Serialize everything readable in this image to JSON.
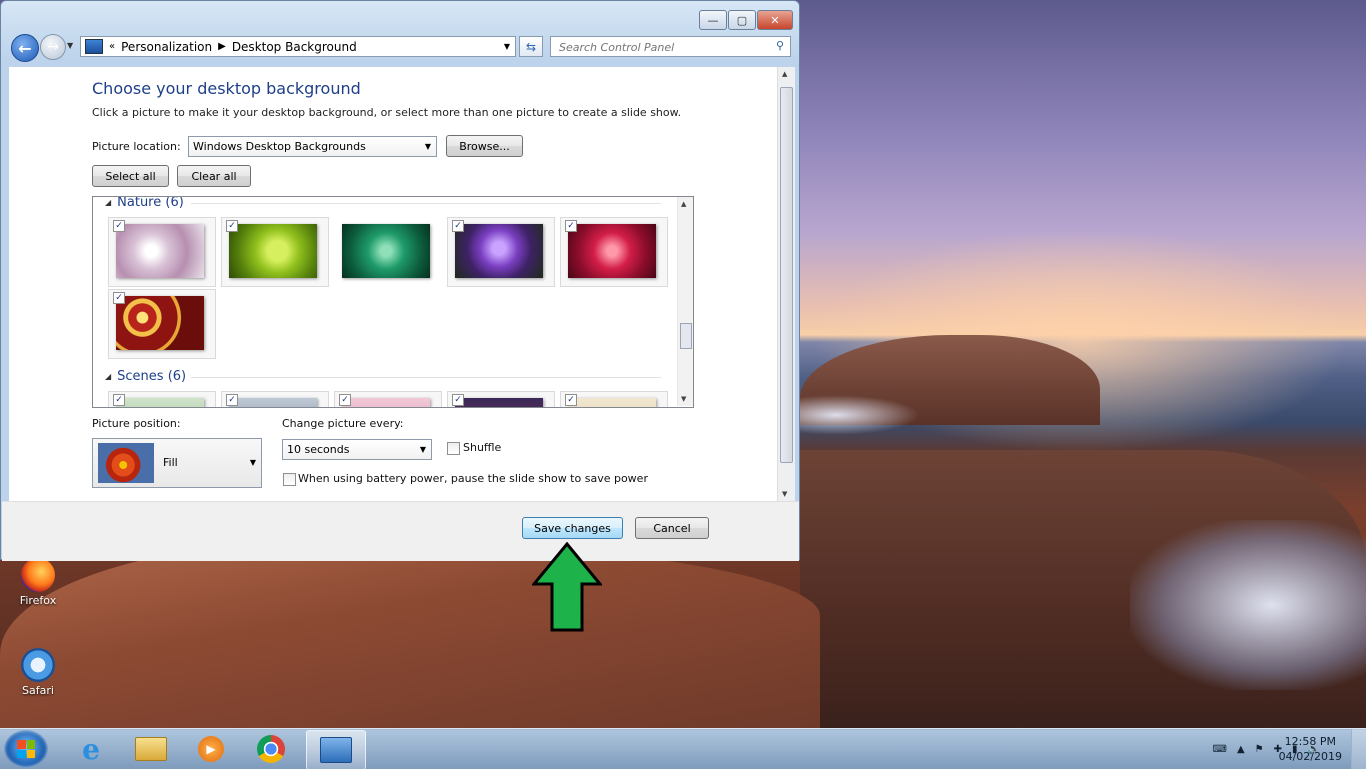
{
  "window": {
    "caption_buttons": {
      "minimize": "—",
      "maximize": "▢",
      "close": "✕"
    },
    "breadcrumb": {
      "prefix": "«",
      "items": [
        "Personalization",
        "Desktop Background"
      ]
    },
    "search_placeholder": "Search Control Panel"
  },
  "content": {
    "title": "Choose your desktop background",
    "description": "Click a picture to make it your desktop background, or select more than one picture to create a slide show.",
    "picture_location_label": "Picture location:",
    "picture_location_value": "Windows Desktop Backgrounds",
    "browse_label": "Browse...",
    "select_all_label": "Select all",
    "clear_all_label": "Clear all",
    "groups": [
      {
        "label": "Nature (6)"
      },
      {
        "label": "Scenes (6)"
      }
    ],
    "picture_position_label": "Picture position:",
    "picture_position_value": "Fill",
    "change_picture_label": "Change picture every:",
    "change_picture_value": "10 seconds",
    "shuffle_label": "Shuffle",
    "battery_label": "When using battery power, pause the slide show to save power"
  },
  "footer": {
    "save_label": "Save changes",
    "cancel_label": "Cancel"
  },
  "desktop_icons": [
    {
      "label": "Firefox"
    },
    {
      "label": "Safari"
    }
  ],
  "taskbar": {
    "time": "12:58 PM",
    "date": "04/02/2019"
  },
  "colors": {
    "accent_title": "#1e3f8a",
    "arrow_green": "#1db24a"
  }
}
